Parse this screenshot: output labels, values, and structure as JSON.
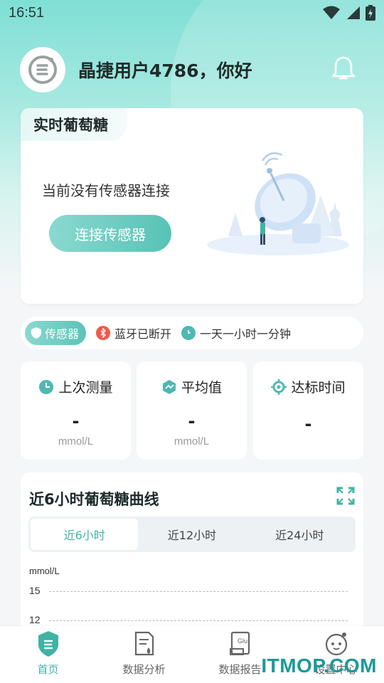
{
  "status_bar": {
    "time": "16:51"
  },
  "header": {
    "greeting": "晶捷用户4786，你好"
  },
  "realtime": {
    "tab_label": "实时葡萄糖",
    "message": "当前没有传感器连接",
    "connect_button": "连接传感器"
  },
  "sensor_status": {
    "sensor_label": "传感器",
    "bluetooth_status": "蓝牙已断开",
    "duration": "一天一小时一分钟"
  },
  "stats": [
    {
      "title": "上次测量",
      "value": "-",
      "unit": "mmol/L",
      "icon": "clock-icon"
    },
    {
      "title": "平均值",
      "value": "-",
      "unit": "mmol/L",
      "icon": "average-icon"
    },
    {
      "title": "达标时间",
      "value": "-",
      "unit": "",
      "icon": "target-icon"
    }
  ],
  "curve": {
    "title": "近6小时葡萄糖曲线",
    "tabs": [
      "近6小时",
      "近12小时",
      "近24小时"
    ],
    "active_tab": 0,
    "y_unit": "mmol/L",
    "gridlines": [
      "15",
      "12"
    ]
  },
  "bottom_nav": [
    {
      "label": "首页",
      "icon": "home-icon",
      "active": true
    },
    {
      "label": "数据分析",
      "icon": "analysis-icon",
      "active": false
    },
    {
      "label": "数据报告",
      "icon": "report-icon",
      "active": false
    },
    {
      "label": "设置中心",
      "icon": "profile-icon",
      "active": false
    }
  ],
  "watermark": "ITMOP.COM",
  "colors": {
    "accent": "#3fb3a5",
    "bluetooth_red": "#f05a4a",
    "clock_teal": "#4fb8b2"
  }
}
